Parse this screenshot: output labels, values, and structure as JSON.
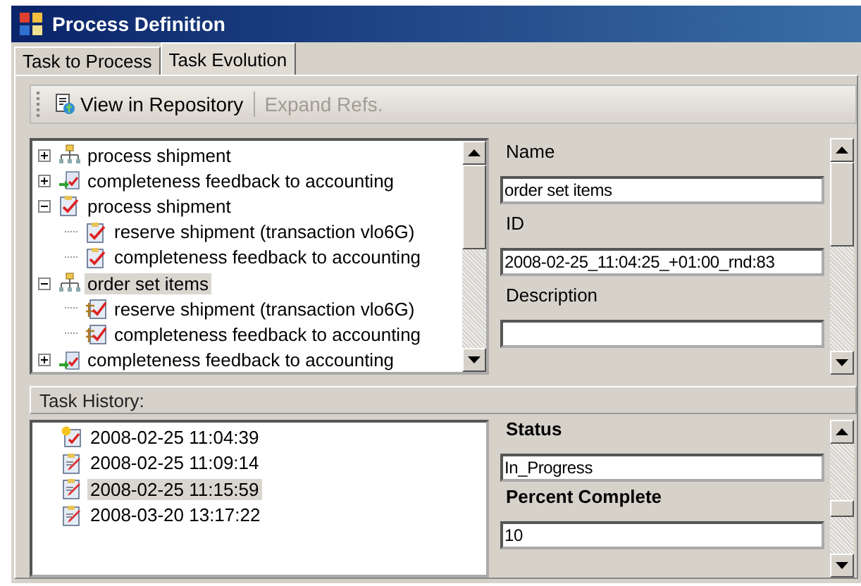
{
  "window": {
    "title": "Process Definition"
  },
  "tabs": [
    {
      "label": "Task to Process",
      "selected": false
    },
    {
      "label": "Task Evolution",
      "selected": true
    }
  ],
  "toolbar": [
    {
      "label": "View in Repository",
      "disabled": false
    },
    {
      "label": "Expand Refs.",
      "disabled": true
    }
  ],
  "tree": [
    {
      "label": "process shipment",
      "kind": "process",
      "expanded": false,
      "selected": false
    },
    {
      "label": "completeness feedback to accounting",
      "kind": "feedback",
      "expanded": false,
      "selected": false
    },
    {
      "label": "process shipment",
      "kind": "task",
      "expanded": true,
      "selected": false,
      "children": [
        {
          "label": "reserve shipment (transaction vlo6G)",
          "kind": "task",
          "selected": false
        },
        {
          "label": "completeness feedback to accounting",
          "kind": "task",
          "selected": false
        }
      ]
    },
    {
      "label": "order set items",
      "kind": "process",
      "expanded": true,
      "selected": true,
      "children": [
        {
          "label": "reserve shipment (transaction vlo6G)",
          "kind": "taskref",
          "selected": false
        },
        {
          "label": "completeness feedback to accounting",
          "kind": "taskref",
          "selected": false
        }
      ]
    },
    {
      "label": "completeness feedback to accounting",
      "kind": "feedback",
      "expanded": false,
      "selected": false
    }
  ],
  "properties": [
    {
      "label": "Name",
      "value": "order set items"
    },
    {
      "label": "ID",
      "value": "2008-02-25_11:04:25_+01:00_rnd:83"
    },
    {
      "label": "Description"
    }
  ],
  "history": {
    "title": "Task History:",
    "items": [
      {
        "label": "2008-02-25 11:04:39",
        "kind": "created",
        "selected": false
      },
      {
        "label": "2008-02-25 11:09:14",
        "kind": "edited",
        "selected": false
      },
      {
        "label": "2008-02-25 11:15:59",
        "kind": "edited",
        "selected": true
      },
      {
        "label": "2008-03-20 13:17:22",
        "kind": "edited",
        "selected": false
      }
    ],
    "properties": [
      {
        "label": "Status",
        "value": "In_Progress"
      },
      {
        "label": "Percent Complete",
        "value": "10"
      }
    ]
  }
}
